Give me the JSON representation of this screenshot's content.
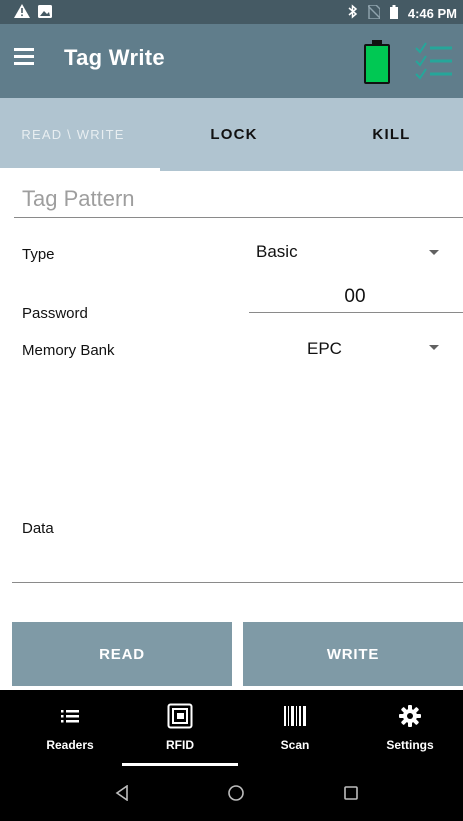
{
  "status_bar": {
    "time": "4:46 PM",
    "left_icons": [
      "warning-icon",
      "image-icon"
    ],
    "right_icons": [
      "bluetooth-icon",
      "no-sim-icon",
      "battery-status-icon"
    ]
  },
  "app_bar": {
    "menu_icon": "hamburger-icon",
    "title": "Tag Write",
    "battery_color": "#00c853",
    "checklist_color": "#00897b"
  },
  "tabs": [
    {
      "label": "READ \\ WRITE",
      "active": true
    },
    {
      "label": "LOCK",
      "active": false
    },
    {
      "label": "KILL",
      "active": false
    }
  ],
  "form": {
    "tag_pattern_placeholder": "Tag Pattern",
    "type_label": "Type",
    "type_value": "Basic",
    "password_label": "Password",
    "password_value": "00",
    "memory_bank_label": "Memory Bank",
    "memory_bank_value": "EPC",
    "data_label": "Data"
  },
  "actions": {
    "read_label": "READ",
    "write_label": "WRITE"
  },
  "bottom_nav": [
    {
      "label": "Readers",
      "icon": "list-icon"
    },
    {
      "label": "RFID",
      "icon": "rfid-icon",
      "active": true
    },
    {
      "label": "Scan",
      "icon": "barcode-icon"
    },
    {
      "label": "Settings",
      "icon": "gear-icon"
    }
  ],
  "system_nav": [
    "back-icon",
    "home-icon",
    "recents-icon"
  ]
}
